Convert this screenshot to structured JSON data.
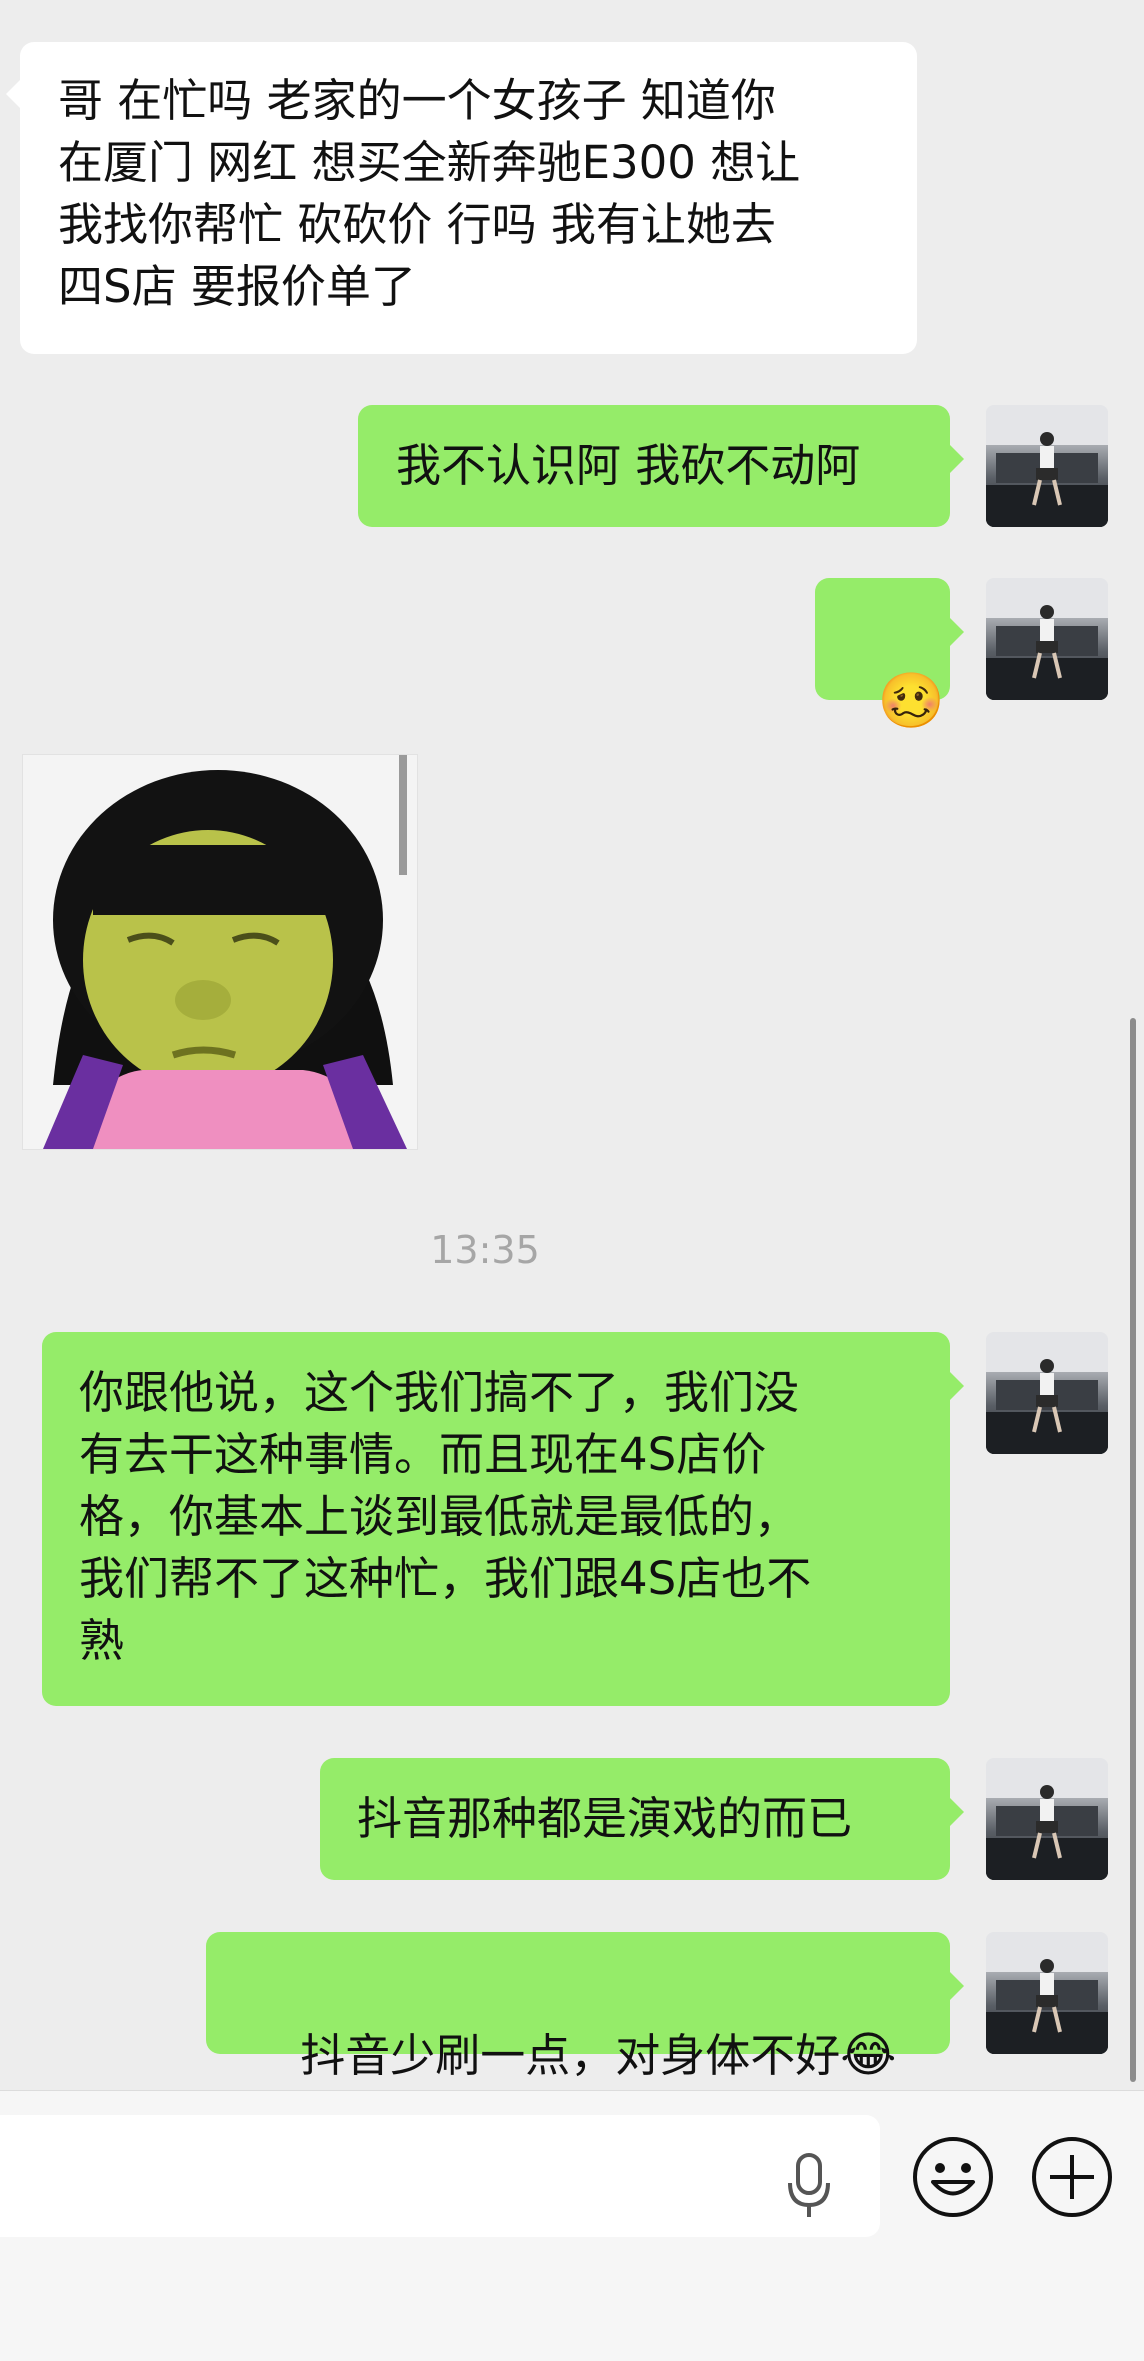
{
  "messages": [
    {
      "from": "other",
      "text": "哥 在忙吗 老家的一个女孩子 知道你\n在厦门 网红 想买全新奔驰E300 想让\n我找你帮忙 砍砍价 行吗 我有让她去\n四S店 要报价单了"
    },
    {
      "from": "me",
      "text": "我不认识阿 我砍不动阿"
    },
    {
      "from": "me",
      "emoji": "🥴"
    },
    {
      "from": "other",
      "sticker": "crying-cartoon-girl-sticker"
    },
    {
      "from": "me",
      "text": "你跟他说，这个我们搞不了，我们没\n有去干这种事情。而且现在4S店价\n格，你基本上谈到最低就是最低的，\n我们帮不了这种忙，我们跟4S店也不\n熟"
    },
    {
      "from": "me",
      "text": "抖音那种都是演戏的而已"
    },
    {
      "from": "me",
      "text": "抖音少刷一点，对身体不好",
      "emoji": "😂"
    }
  ],
  "timestamp": "13:35",
  "input_bar": {
    "voice_icon": "microphone-icon",
    "emoji_icon": "smiley-face-icon",
    "more_icon": "plus-circle-icon"
  },
  "colors": {
    "background": "#ededed",
    "incoming_bubble": "#ffffff",
    "outgoing_bubble": "#95ec69",
    "timestamp_text": "#a6a6a6"
  }
}
